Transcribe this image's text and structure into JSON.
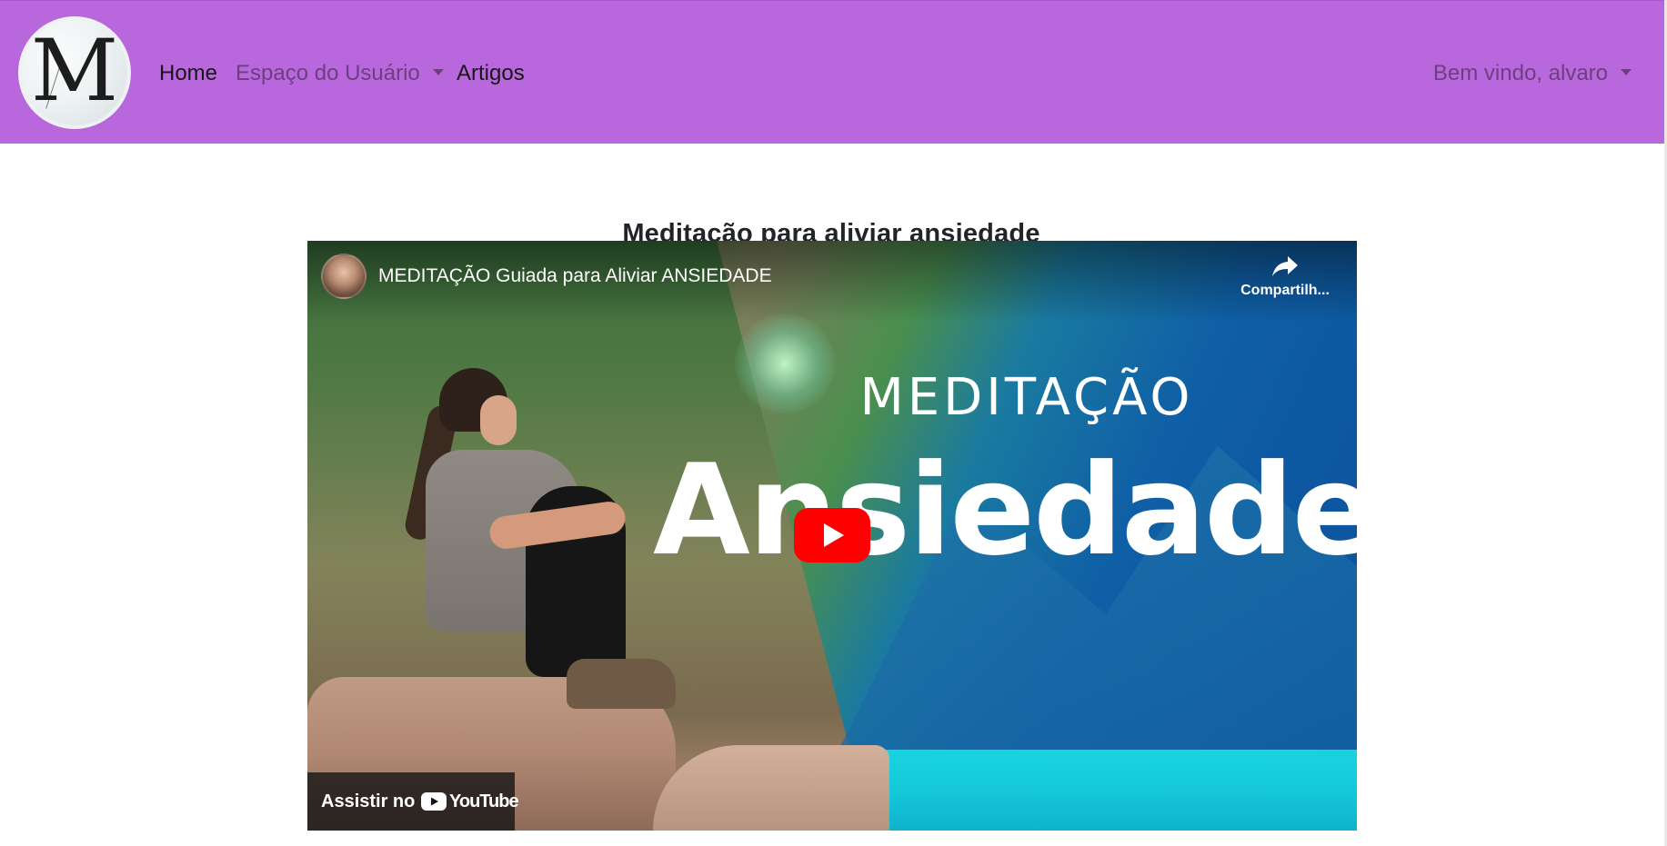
{
  "navbar": {
    "logo_letter": "M",
    "links": {
      "home": "Home",
      "espaco": "Espaço do Usuário",
      "artigos": "Artigos"
    },
    "user_menu": "Bem vindo, alvaro"
  },
  "main": {
    "title": "Meditação para aliviar ansiedade"
  },
  "video": {
    "title": "MEDITAÇÃO Guiada para Aliviar ANSIEDADE",
    "share_label": "Compartilh...",
    "thumbnail_top": "MEDITAÇÃO",
    "thumbnail_main": "Ansiedade",
    "watch_on": "Assistir no",
    "platform": "YouTube"
  },
  "colors": {
    "navbar": "#b868dc",
    "play_button": "#ff0000"
  },
  "icons": {
    "share": "share-icon",
    "play": "play-icon",
    "youtube": "youtube-logo-icon",
    "caret": "caret-down-icon"
  }
}
